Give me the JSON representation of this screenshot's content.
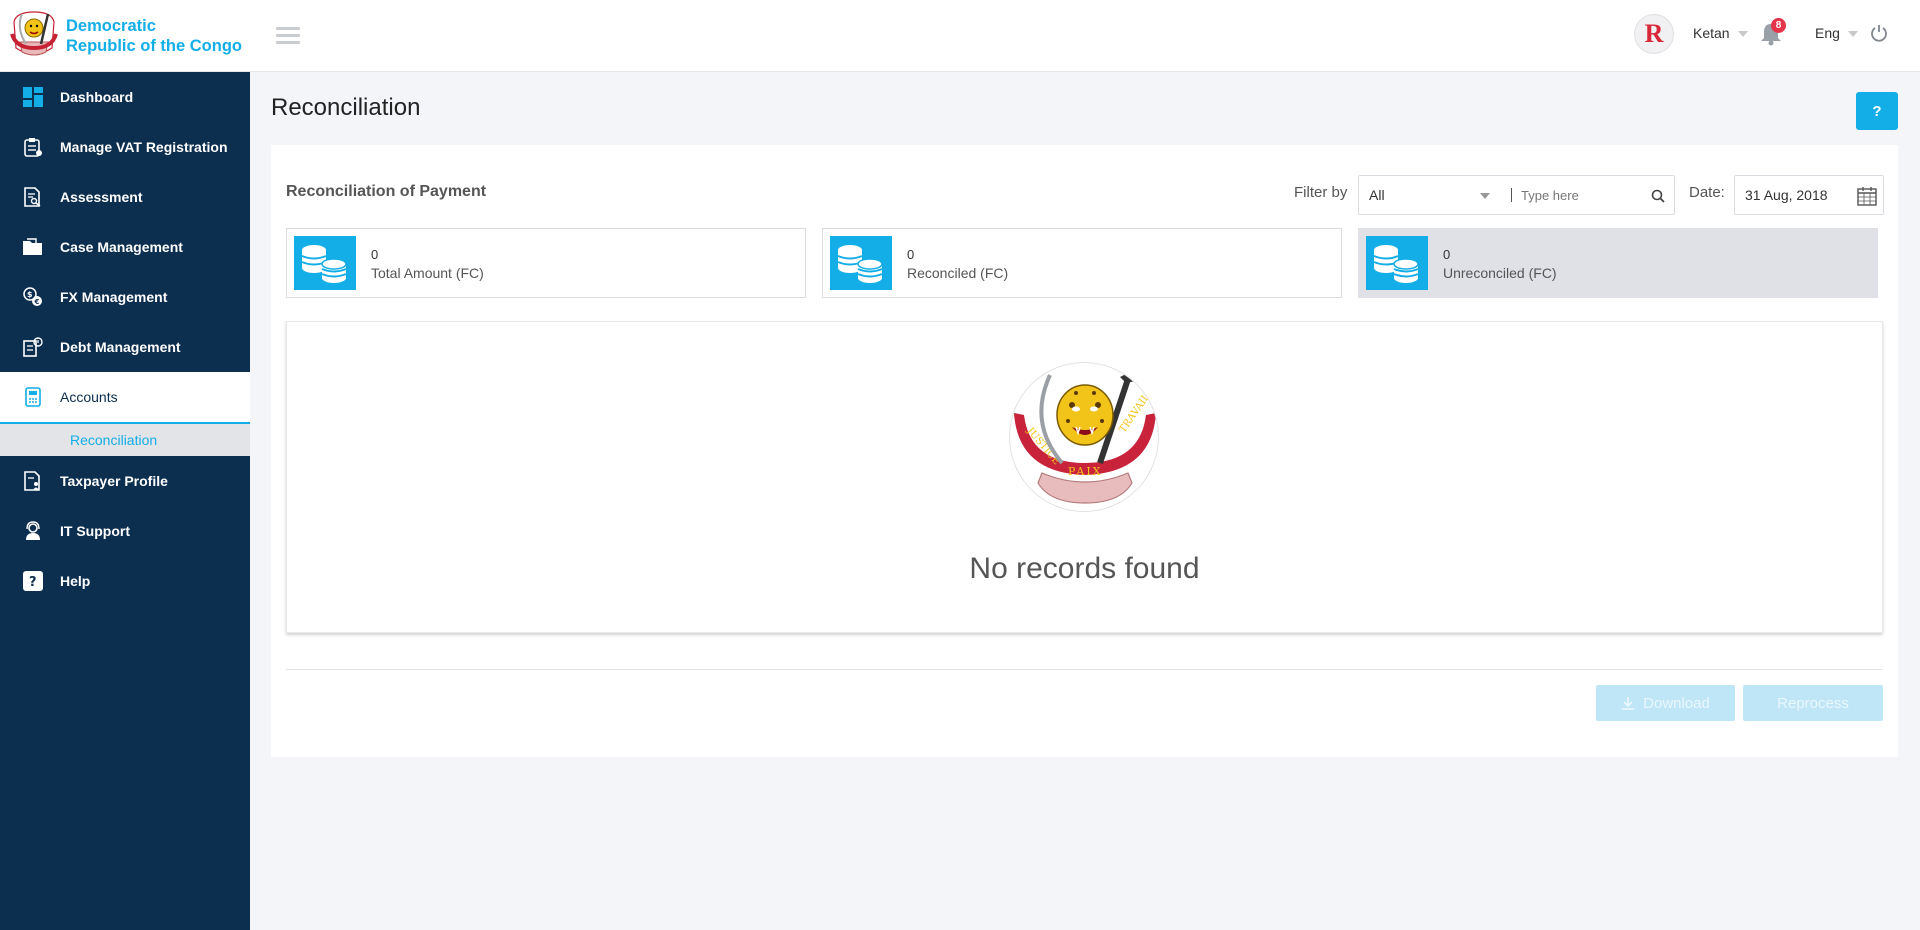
{
  "brand": {
    "line1": "Democratic",
    "line2": "Republic of the Congo"
  },
  "sidebar": {
    "items": [
      {
        "label": "Dashboard",
        "icon": "dashboard-icon"
      },
      {
        "label": "Manage VAT Registration",
        "icon": "clipboard-icon"
      },
      {
        "label": "Assessment",
        "icon": "document-search-icon"
      },
      {
        "label": "Case Management",
        "icon": "folder-icon"
      },
      {
        "label": "FX Management",
        "icon": "currency-exchange-icon"
      },
      {
        "label": "Debt Management",
        "icon": "debt-icon"
      },
      {
        "label": "Accounts",
        "icon": "calculator-icon",
        "active": true
      },
      {
        "label": "Taxpayer Profile",
        "icon": "profile-document-icon"
      },
      {
        "label": "IT Support",
        "icon": "support-agent-icon"
      },
      {
        "label": "Help",
        "icon": "question-icon"
      }
    ],
    "sub_item": "Reconciliation"
  },
  "topbar": {
    "user": "Ketan",
    "notification_count": "8",
    "language": "Eng",
    "avatar_letter": "R"
  },
  "page": {
    "title": "Reconciliation",
    "help_label": "?"
  },
  "card": {
    "heading": "Reconciliation of Payment",
    "filter_label": "Filter by",
    "filter_value": "All",
    "search_placeholder": "Type here",
    "date_label": "Date:",
    "date_value": "31 Aug, 2018"
  },
  "stats": [
    {
      "value": "0",
      "label": "Total Amount (FC)"
    },
    {
      "value": "0",
      "label": "Reconciled (FC)"
    },
    {
      "value": "0",
      "label": "Unreconciled (FC)"
    }
  ],
  "empty": {
    "message": "No records found",
    "emblem_words": [
      "JUSTICE",
      "PAIX",
      "TRAVAIL"
    ]
  },
  "actions": {
    "download": "Download",
    "reprocess": "Reprocess"
  },
  "colors": {
    "accent": "#13aee8",
    "sidebar": "#0d2f4f",
    "badge": "#e4344a"
  }
}
